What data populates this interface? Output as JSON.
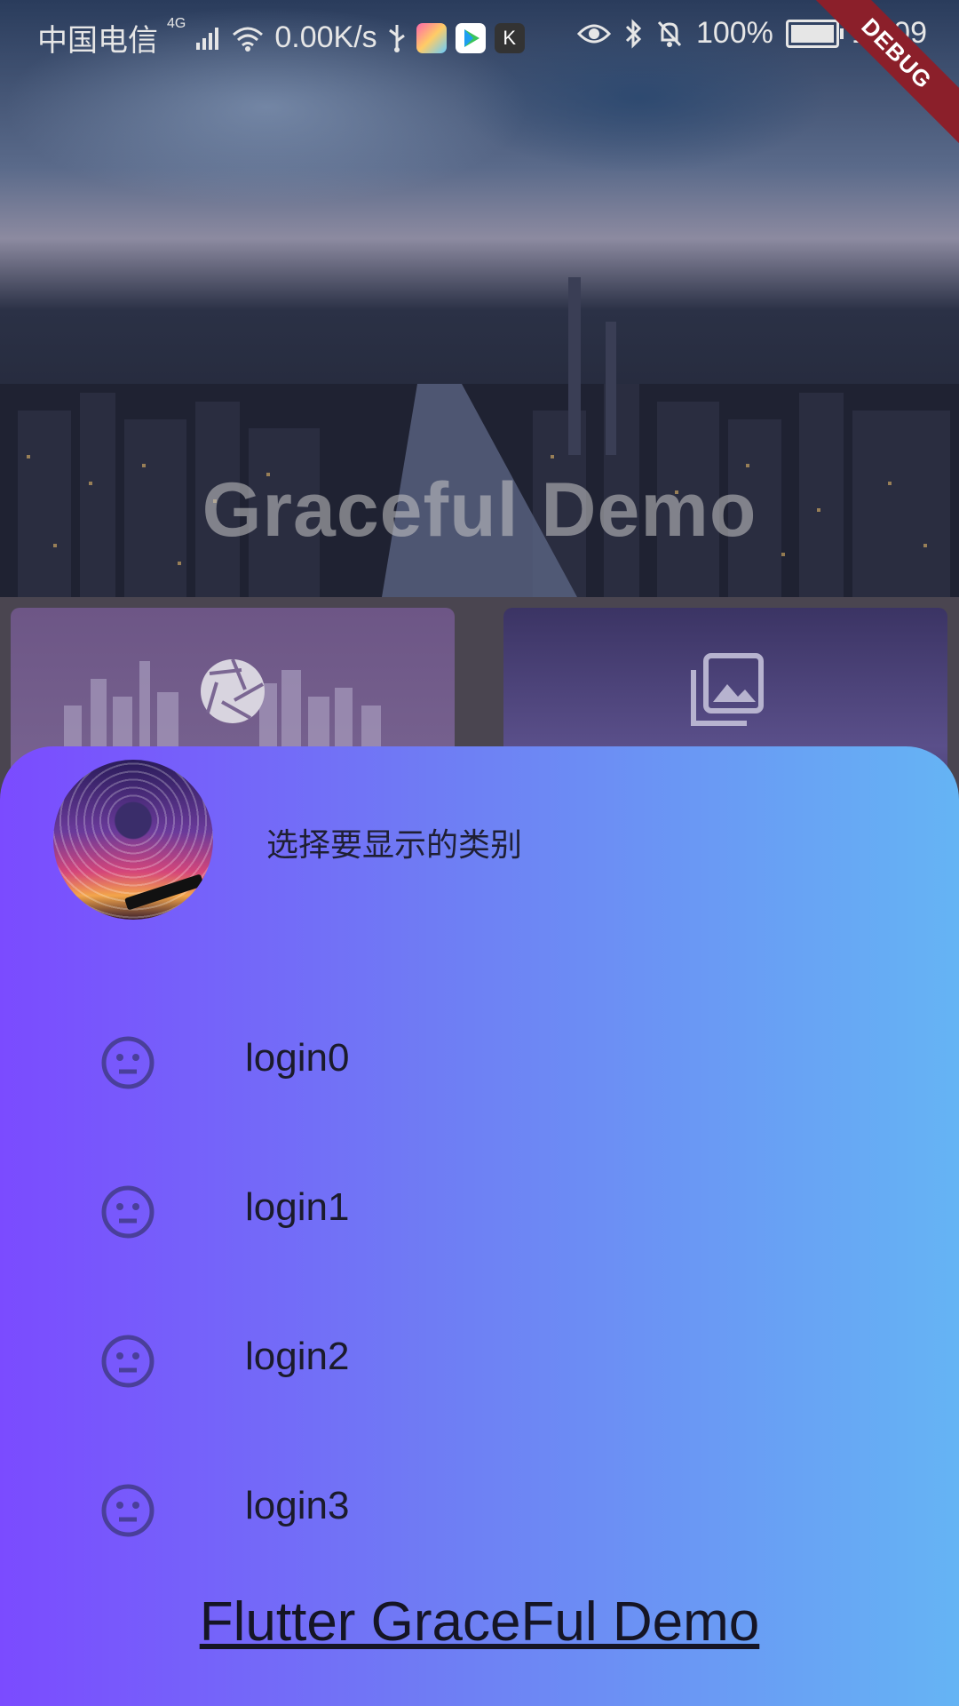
{
  "status_bar": {
    "carrier": "中国电信",
    "network": "4G",
    "speed": "0.00K/s",
    "battery": "100%",
    "time": "15:09",
    "icons": [
      "signal-icon",
      "wifi-icon",
      "usb-icon",
      "app-icon",
      "play-icon",
      "k-app-icon",
      "eye-icon",
      "bluetooth-icon",
      "bell-off-icon",
      "battery-icon"
    ]
  },
  "debug_banner": "DEBUG",
  "hero": {
    "title": "Graceful Demo"
  },
  "cards": [
    {
      "icon": "camera-aperture-icon"
    },
    {
      "icon": "photo-library-icon"
    }
  ],
  "drawer": {
    "header": "选择要显示的类别",
    "items": [
      {
        "label": "login0",
        "icon": "neutral-face-icon"
      },
      {
        "label": "login1",
        "icon": "neutral-face-icon"
      },
      {
        "label": "login2",
        "icon": "neutral-face-icon"
      },
      {
        "label": "login3",
        "icon": "neutral-face-icon"
      }
    ],
    "footer_link": "Flutter GraceFul Demo"
  },
  "colors": {
    "drawer_gradient_start": "#7b4bff",
    "drawer_gradient_end": "#65b4f4",
    "icon_color": "#4a3f9a",
    "debug_red": "#8b1f2a"
  }
}
